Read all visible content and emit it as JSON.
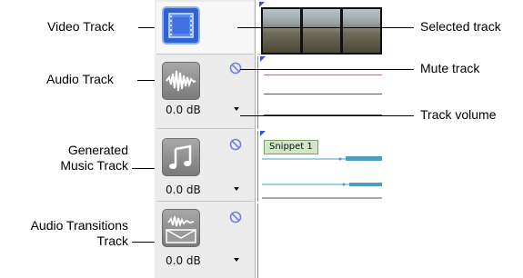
{
  "callouts": {
    "video_track": "Video Track",
    "audio_track": "Audio Track",
    "generated_music_track_line1": "Generated",
    "generated_music_track_line2": "Music Track",
    "audio_transitions_track_line1": "Audio Transitions",
    "audio_transitions_track_line2": "Track",
    "selected_track": "Selected track",
    "mute_track": "Mute track",
    "track_volume": "Track volume"
  },
  "tracks": [
    {
      "type": "video",
      "icon": "film-strip-icon",
      "selected": true
    },
    {
      "type": "audio",
      "icon": "audio-waveform-icon",
      "volume": "0.0 dB",
      "mute_icon": "mute-icon"
    },
    {
      "type": "generated-music",
      "icon": "music-note-icon",
      "volume": "0.0 dB",
      "mute_icon": "mute-icon"
    },
    {
      "type": "audio-transitions",
      "icon": "audio-transition-icon",
      "volume": "0.0 dB",
      "mute_icon": "mute-icon"
    }
  ],
  "timeline": {
    "snippet_label": "Snippet 1"
  },
  "colors": {
    "video_icon": "#2f63d4",
    "mute_icon": "#6f7fe0",
    "audio_line_top": "#b07a8a",
    "music_wave": "#4aa0b8"
  }
}
